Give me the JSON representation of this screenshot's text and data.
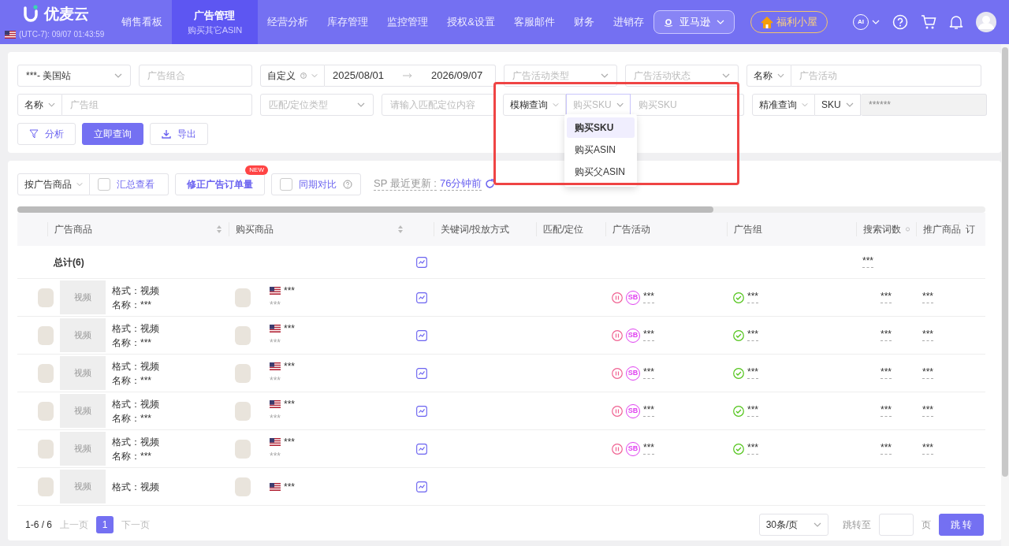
{
  "header": {
    "logo": "优麦云",
    "timezone": "(UTC-7): 09/07 01:43:59",
    "menu": [
      {
        "label": "销售看板",
        "selected": false
      },
      {
        "label": "广告管理",
        "sub": "购买其它ASIN",
        "selected": true
      },
      {
        "label": "经营分析",
        "selected": false
      },
      {
        "label": "库存管理",
        "selected": false
      },
      {
        "label": "监控管理",
        "selected": false
      },
      {
        "label": "授权&设置",
        "selected": false
      },
      {
        "label": "客服邮件",
        "selected": false
      },
      {
        "label": "财务",
        "selected": false
      },
      {
        "label": "进销存",
        "selected": false
      }
    ],
    "platform": "亚马逊",
    "welfare": "福利小屋",
    "ai": "AI"
  },
  "filters": {
    "shop": "***- 美国站",
    "portfolio_placeholder": "广告组合",
    "date_mode": "自定义",
    "date_start": "2025/08/01",
    "date_end": "2026/09/07",
    "campaign_type_placeholder": "广告活动类型",
    "campaign_status_placeholder": "广告活动状态",
    "campaign_field": "名称",
    "campaign_placeholder": "广告活动",
    "adgroup_field": "名称",
    "adgroup_placeholder": "广告组",
    "match_type_placeholder": "匹配/定位类型",
    "match_content_placeholder": "请输入匹配定位内容",
    "fuzzy_mode": "模糊查询",
    "buy_field": "购买SKU",
    "buy_placeholder": "购买SKU",
    "exact_mode": "精准查询",
    "exact_field": "SKU",
    "exact_value": "******",
    "dropdown": [
      {
        "label": "购买SKU",
        "selected": true
      },
      {
        "label": "购买ASIN",
        "selected": false
      },
      {
        "label": "购买父ASIN",
        "selected": false
      }
    ],
    "highlight": true,
    "buttons": [
      {
        "kind": "analyze",
        "label": "分析"
      },
      {
        "kind": "primary",
        "label": "立即查询"
      },
      {
        "kind": "export",
        "label": "导出"
      }
    ]
  },
  "toolbar": {
    "group_by": "按广告商品",
    "summary": {
      "label": "汇总查看",
      "checked": false
    },
    "fix_button": "修正广告订单量",
    "fix_badge": "NEW",
    "compare": {
      "label": "同期对比",
      "checked": false
    },
    "update_label": "SP 最近更新 :",
    "update_time": "76分钟前"
  },
  "table": {
    "columns": [
      {
        "kind": "select"
      },
      {
        "kind": "text",
        "label": "广告商品",
        "sortable": true
      },
      {
        "kind": "text",
        "label": "购买商品",
        "sortable": true
      },
      {
        "kind": "chart"
      },
      {
        "label": "关键词/投放方式"
      },
      {
        "label": "匹配/定位"
      },
      {
        "label": "广告活动"
      },
      {
        "label": "广告组"
      },
      {
        "label": "搜索词数",
        "help": true
      },
      {
        "label": "推广商品"
      },
      {
        "label": "订"
      }
    ],
    "total": {
      "label": "总计(6)",
      "search_terms": "***"
    },
    "rows": [
      {
        "format": "格式：视频",
        "name": "名称：***",
        "video": "视频",
        "buy": "***",
        "buy_sub": "***",
        "campaign": "***",
        "campaign_badge": "SB",
        "adgroup": "***",
        "search_terms": "***",
        "promoted": "***"
      },
      {
        "format": "格式：视频",
        "name": "名称：***",
        "video": "视频",
        "buy": "***",
        "buy_sub": "***",
        "campaign": "***",
        "campaign_badge": "SB",
        "adgroup": "***",
        "search_terms": "***",
        "promoted": "***"
      },
      {
        "format": "格式：视频",
        "name": "名称：***",
        "video": "视频",
        "buy": "***",
        "buy_sub": "***",
        "campaign": "***",
        "campaign_badge": "SB",
        "adgroup": "***",
        "search_terms": "***",
        "promoted": "***"
      },
      {
        "format": "格式：视频",
        "name": "名称：***",
        "video": "视频",
        "buy": "***",
        "buy_sub": "***",
        "campaign": "***",
        "campaign_badge": "SB",
        "adgroup": "***",
        "search_terms": "***",
        "promoted": "***"
      },
      {
        "format": "格式：视频",
        "name": "名称：***",
        "video": "视频",
        "buy": "***",
        "buy_sub": "***",
        "campaign": "***",
        "campaign_badge": "SB",
        "adgroup": "***",
        "search_terms": "***",
        "promoted": "***"
      },
      {
        "format": "格式：视频",
        "video": "视频",
        "buy": "***"
      }
    ]
  },
  "pagination": {
    "range": "1-6 / 6",
    "prev": "上一页",
    "pages": [
      {
        "label": "1",
        "selected": true
      }
    ],
    "next": "下一页",
    "page_size": "30条/页",
    "jump_label": "跳转至",
    "page_unit": "页",
    "go": "跳 转"
  }
}
